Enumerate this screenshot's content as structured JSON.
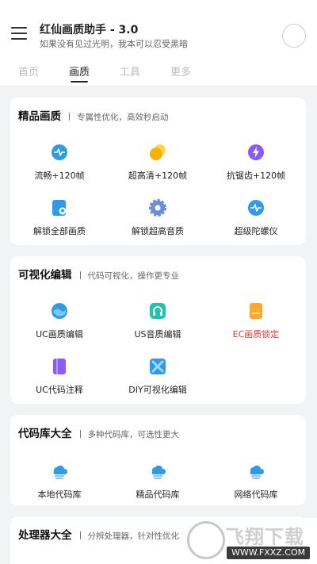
{
  "header": {
    "title": "红仙画质助手 - 3.0",
    "subtitle": "如果没有见过光明，我本可以忍受黑暗"
  },
  "tabs": [
    {
      "label": "首页",
      "active": false
    },
    {
      "label": "画质",
      "active": true
    },
    {
      "label": "工具",
      "active": false
    },
    {
      "label": "更多",
      "active": false
    }
  ],
  "sections": [
    {
      "title": "精品画质",
      "desc": "专属性优化，高效秒启动",
      "items": [
        {
          "label": "流畅+120帧",
          "icon": "pulse-icon"
        },
        {
          "label": "超高清+120帧",
          "icon": "circles-icon"
        },
        {
          "label": "抗锯齿+120帧",
          "icon": "lightning-icon"
        },
        {
          "label": "解锁全部画质",
          "icon": "document-location-icon"
        },
        {
          "label": "解锁超高音质",
          "icon": "gear-icon"
        },
        {
          "label": "超级陀螺仪",
          "icon": "pulse-icon"
        }
      ]
    },
    {
      "title": "可视化编辑",
      "desc": "代码可视化，操作更专业",
      "items": [
        {
          "label": "UC画质编辑",
          "icon": "globe-icon"
        },
        {
          "label": "US音质编辑",
          "icon": "headphones-icon"
        },
        {
          "label": "EC画质锁定",
          "icon": "folder-icon",
          "highlight": true
        },
        {
          "label": "UC代码注释",
          "icon": "book-icon"
        },
        {
          "label": "DIY可视化编辑",
          "icon": "diy-icon"
        }
      ]
    },
    {
      "title": "代码库大全",
      "desc": "多种代码库，可选性更大",
      "items": [
        {
          "label": "本地代码库",
          "icon": "cloud-stack-icon"
        },
        {
          "label": "精品代码库",
          "icon": "cloud-stack-icon"
        },
        {
          "label": "网络代码库",
          "icon": "cloud-stack-icon"
        }
      ]
    },
    {
      "title": "处理器大全",
      "desc": "分辨处理器，针对性优化"
    }
  ],
  "watermark": {
    "text": "飞翔下载",
    "url": "WWW.FXXZ.COM"
  },
  "colors": {
    "accent_blue": "#2f9be8",
    "accent_yellow": "#f5b400",
    "accent_purple": "#8a5cf6",
    "accent_teal": "#1fc2b4",
    "accent_orange": "#ffa726",
    "highlight_red": "#e53935"
  }
}
